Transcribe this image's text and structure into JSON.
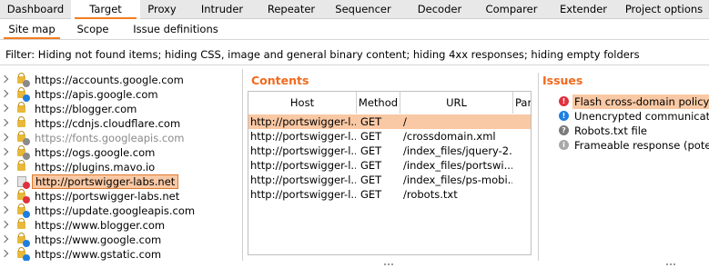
{
  "top_tabs": [
    "Dashboard",
    "Target",
    "Proxy",
    "Intruder",
    "Repeater",
    "Sequencer",
    "Decoder",
    "Comparer",
    "Extender",
    "Project options"
  ],
  "active_top_tab": "Target",
  "sub_tabs": [
    "Site map",
    "Scope",
    "Issue definitions"
  ],
  "active_sub_tab": "Site map",
  "filter_text": "Filter: Hiding not found items;  hiding CSS, image and general binary content;  hiding 4xx responses;  hiding empty folders",
  "site_tree": [
    {
      "label": "https://accounts.google.com",
      "icon": "lock-icon",
      "dot": "gray",
      "dim": false
    },
    {
      "label": "https://apis.google.com",
      "icon": "lock-icon",
      "dot": "blue",
      "dim": false
    },
    {
      "label": "https://blogger.com",
      "icon": "lock-icon",
      "dot": "",
      "dim": false
    },
    {
      "label": "https://cdnjs.cloudflare.com",
      "icon": "lock-icon",
      "dot": "",
      "dim": false
    },
    {
      "label": "https://fonts.googleapis.com",
      "icon": "lock-icon",
      "dot": "gray",
      "dim": true
    },
    {
      "label": "https://ogs.google.com",
      "icon": "lock-icon",
      "dot": "gray",
      "dim": false
    },
    {
      "label": "https://plugins.mavo.io",
      "icon": "lock-icon",
      "dot": "",
      "dim": false
    },
    {
      "label": "http://portswigger-labs.net",
      "icon": "page-icon",
      "dot": "red",
      "dim": false,
      "selected": true
    },
    {
      "label": "https://portswigger-labs.net",
      "icon": "lock-icon",
      "dot": "red",
      "dim": false
    },
    {
      "label": "https://update.googleapis.com",
      "icon": "lock-icon",
      "dot": "blue",
      "dim": false
    },
    {
      "label": "https://www.blogger.com",
      "icon": "lock-icon",
      "dot": "",
      "dim": false
    },
    {
      "label": "https://www.google.com",
      "icon": "lock-icon",
      "dot": "blue",
      "dim": false
    },
    {
      "label": "https://www.gstatic.com",
      "icon": "lock-icon",
      "dot": "blue",
      "dim": false
    }
  ],
  "contents": {
    "title": "Contents",
    "columns": [
      "Host",
      "Method",
      "URL",
      "Para"
    ],
    "rows": [
      {
        "host": "http://portswigger-l...",
        "method": "GET",
        "url": "/",
        "selected": true
      },
      {
        "host": "http://portswigger-l...",
        "method": "GET",
        "url": "/crossdomain.xml"
      },
      {
        "host": "http://portswigger-l...",
        "method": "GET",
        "url": "/index_files/jquery-2..."
      },
      {
        "host": "http://portswigger-l...",
        "method": "GET",
        "url": "/index_files/portswi..."
      },
      {
        "host": "http://portswigger-l...",
        "method": "GET",
        "url": "/index_files/ps-mobi..."
      },
      {
        "host": "http://portswigger-l...",
        "method": "GET",
        "url": "/robots.txt"
      }
    ]
  },
  "issues": {
    "title": "Issues",
    "items": [
      {
        "label": "Flash cross-domain policy",
        "severity": "high",
        "color": "#e0323c",
        "glyph": "!",
        "selected": true
      },
      {
        "label": "Unencrypted communications",
        "severity": "low",
        "color": "#1e7ee0",
        "glyph": "!"
      },
      {
        "label": "Robots.txt file",
        "severity": "info",
        "color": "#7a7a7a",
        "glyph": "?"
      },
      {
        "label": "Frameable response (potential",
        "severity": "info",
        "color": "#a8a8a8",
        "glyph": "i"
      }
    ]
  },
  "colors": {
    "accent": "#f57c1f",
    "selection": "#f9c8a4",
    "dot_red": "#e0323c",
    "dot_blue": "#1e7ee0",
    "dot_gray": "#8a8a8a"
  }
}
